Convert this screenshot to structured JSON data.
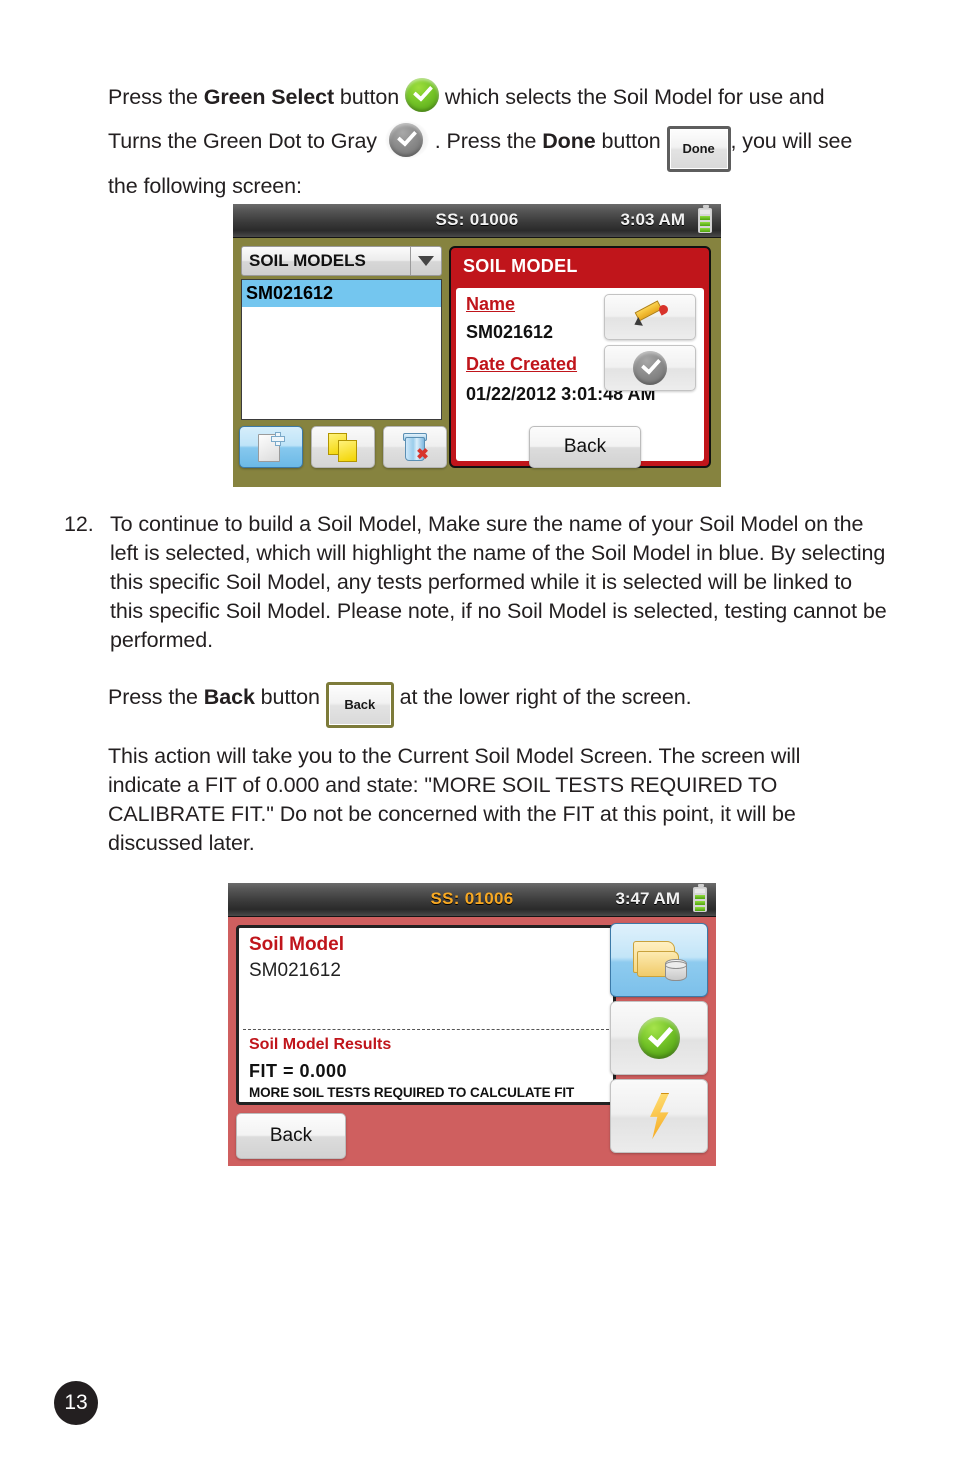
{
  "document": {
    "page_number": "13",
    "intro": {
      "part1": "Press the ",
      "bold1": "Green Select",
      "part2": " button ",
      "icon_green_check": "green-check-icon",
      "part3": " which selects the Soil Model for use and Turns the Green Dot to Gray ",
      "icon_gray_check": "gray-check-icon",
      "part4": " . Press the ",
      "bold2": "Done",
      "part5": " button ",
      "done_button_label": "Done",
      "part6": ", you will see the following screen:"
    },
    "item12": {
      "number": "12.",
      "text": "To continue to build a Soil Model, Make sure the name of your Soil Model on the left is selected, which will highlight the name of the Soil Model in blue. By selecting this specific Soil Model, any tests performed while it is selected will be linked to this specific Soil Model. Please note, if no Soil Model is selected, testing cannot be performed."
    },
    "back_para": {
      "part1": "Press the ",
      "bold1": "Back",
      "part2": " button ",
      "back_button_label": "Back",
      "part3": "  at the lower right of the screen."
    },
    "action_para": {
      "text": "This action will take you to the Current Soil Model Screen. The screen will indicate a FIT of 0.000 and state: \"MORE SOIL TESTS REQUIRED TO CALIBRATE FIT.\" Do not be concerned with the FIT at this point, it will be discussed later."
    }
  },
  "screen_soil_models": {
    "statusbar": {
      "ss": "SS: 01006",
      "time": "3:03 AM",
      "battery_level": 3
    },
    "dropdown": {
      "label": "SOIL MODELS"
    },
    "list": {
      "items": [
        "SM021612"
      ],
      "selected": "SM021612"
    },
    "toolbar": [
      {
        "name": "new-soil-model-button",
        "icon": "new-document-icon",
        "active": true
      },
      {
        "name": "copy-soil-model-button",
        "icon": "copy-pages-icon",
        "active": false
      },
      {
        "name": "delete-soil-model-button",
        "icon": "trash-delete-icon",
        "active": false
      }
    ],
    "card": {
      "title": "SOIL MODEL",
      "name_label": "Name",
      "name_value": "SM021612",
      "date_label": "Date Created",
      "date_value": "01/22/2012 3:01:48 AM",
      "edit_button": "pencil-edit-icon",
      "select_button": "gray-check-icon"
    },
    "back_label": "Back"
  },
  "screen_current_model": {
    "statusbar": {
      "ss": "SS: 01006",
      "time": "3:47 AM",
      "battery_level": 3
    },
    "panel": {
      "title": "Soil Model",
      "value": "SM021612",
      "results_title": "Soil Model Results",
      "fit_line": "FIT =   0.000",
      "note": "MORE SOIL TESTS REQUIRED TO CALCULATE FIT"
    },
    "back_label": "Back",
    "side_buttons": [
      {
        "name": "open-database-button",
        "icon": "folder-database-icon",
        "active": true
      },
      {
        "name": "select-confirm-button",
        "icon": "green-check-icon",
        "active": false
      },
      {
        "name": "run-test-button",
        "icon": "lightning-bolt-icon",
        "active": false
      }
    ]
  },
  "colors": {
    "accent_red": "#c0151b",
    "panel_red": "#cf5f5f",
    "olive": "#86833f",
    "list_highlight_blue": "#74c6ef",
    "green": "#72c227",
    "amber_text": "#f7a823"
  }
}
